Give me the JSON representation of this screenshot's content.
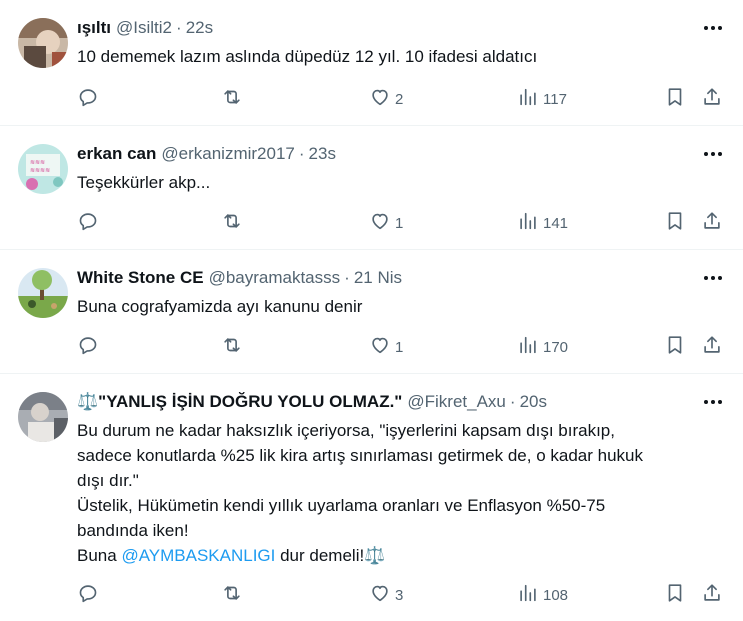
{
  "tweets": [
    {
      "name": "ışıltı",
      "handle": "@Isilti2",
      "time": "22s",
      "text": "10 dememek lazım aslında düpedüz 12 yıl. 10 ifadesi aldatıcı",
      "replies": "",
      "retweets": "",
      "likes": "2",
      "views": "117"
    },
    {
      "name": "erkan can",
      "handle": "@erkanizmir2017",
      "time": "23s",
      "text": "Teşekkürler akp...",
      "replies": "",
      "retweets": "",
      "likes": "1",
      "views": "141"
    },
    {
      "name": "White Stone CE",
      "handle": "@bayramaktasss",
      "time": "21 Nis",
      "text": "Buna cografyamizda ayı kanunu denir",
      "replies": "",
      "retweets": "",
      "likes": "1",
      "views": "170"
    },
    {
      "name": "⚖️\"YANLIŞ İŞİN DOĞRU YOLU OLMAZ.\"",
      "handle": "@Fikret_Axu",
      "time": "20s",
      "text_lines": [
        "Bu durum ne kadar haksızlık içeriyorsa, \"işyerlerini kapsam dışı bırakıp,",
        "sadece konutlarda %25 lik kira artış sınırlaması getirmek de, o kadar hukuk",
        "dışı dır.\"",
        "Üstelik, Hükümetin kendi yıllık uyarlama oranları ve Enflasyon %50-75",
        "bandında iken!"
      ],
      "last_line_prefix": "Buna ",
      "mention": "@AYMBASKANLIGI",
      "last_line_suffix": " dur demeli!⚖️",
      "replies": "",
      "retweets": "",
      "likes": "3",
      "views": "108"
    }
  ],
  "icons": {
    "more": "more-icon",
    "reply": "reply-icon",
    "retweet": "retweet-icon",
    "like": "heart-icon",
    "views": "views-icon",
    "bookmark": "bookmark-icon",
    "share": "share-icon"
  },
  "colors": {
    "text": "#0f1419",
    "secondary": "#536471",
    "link": "#1d9bf0",
    "divider": "#eff3f4"
  }
}
